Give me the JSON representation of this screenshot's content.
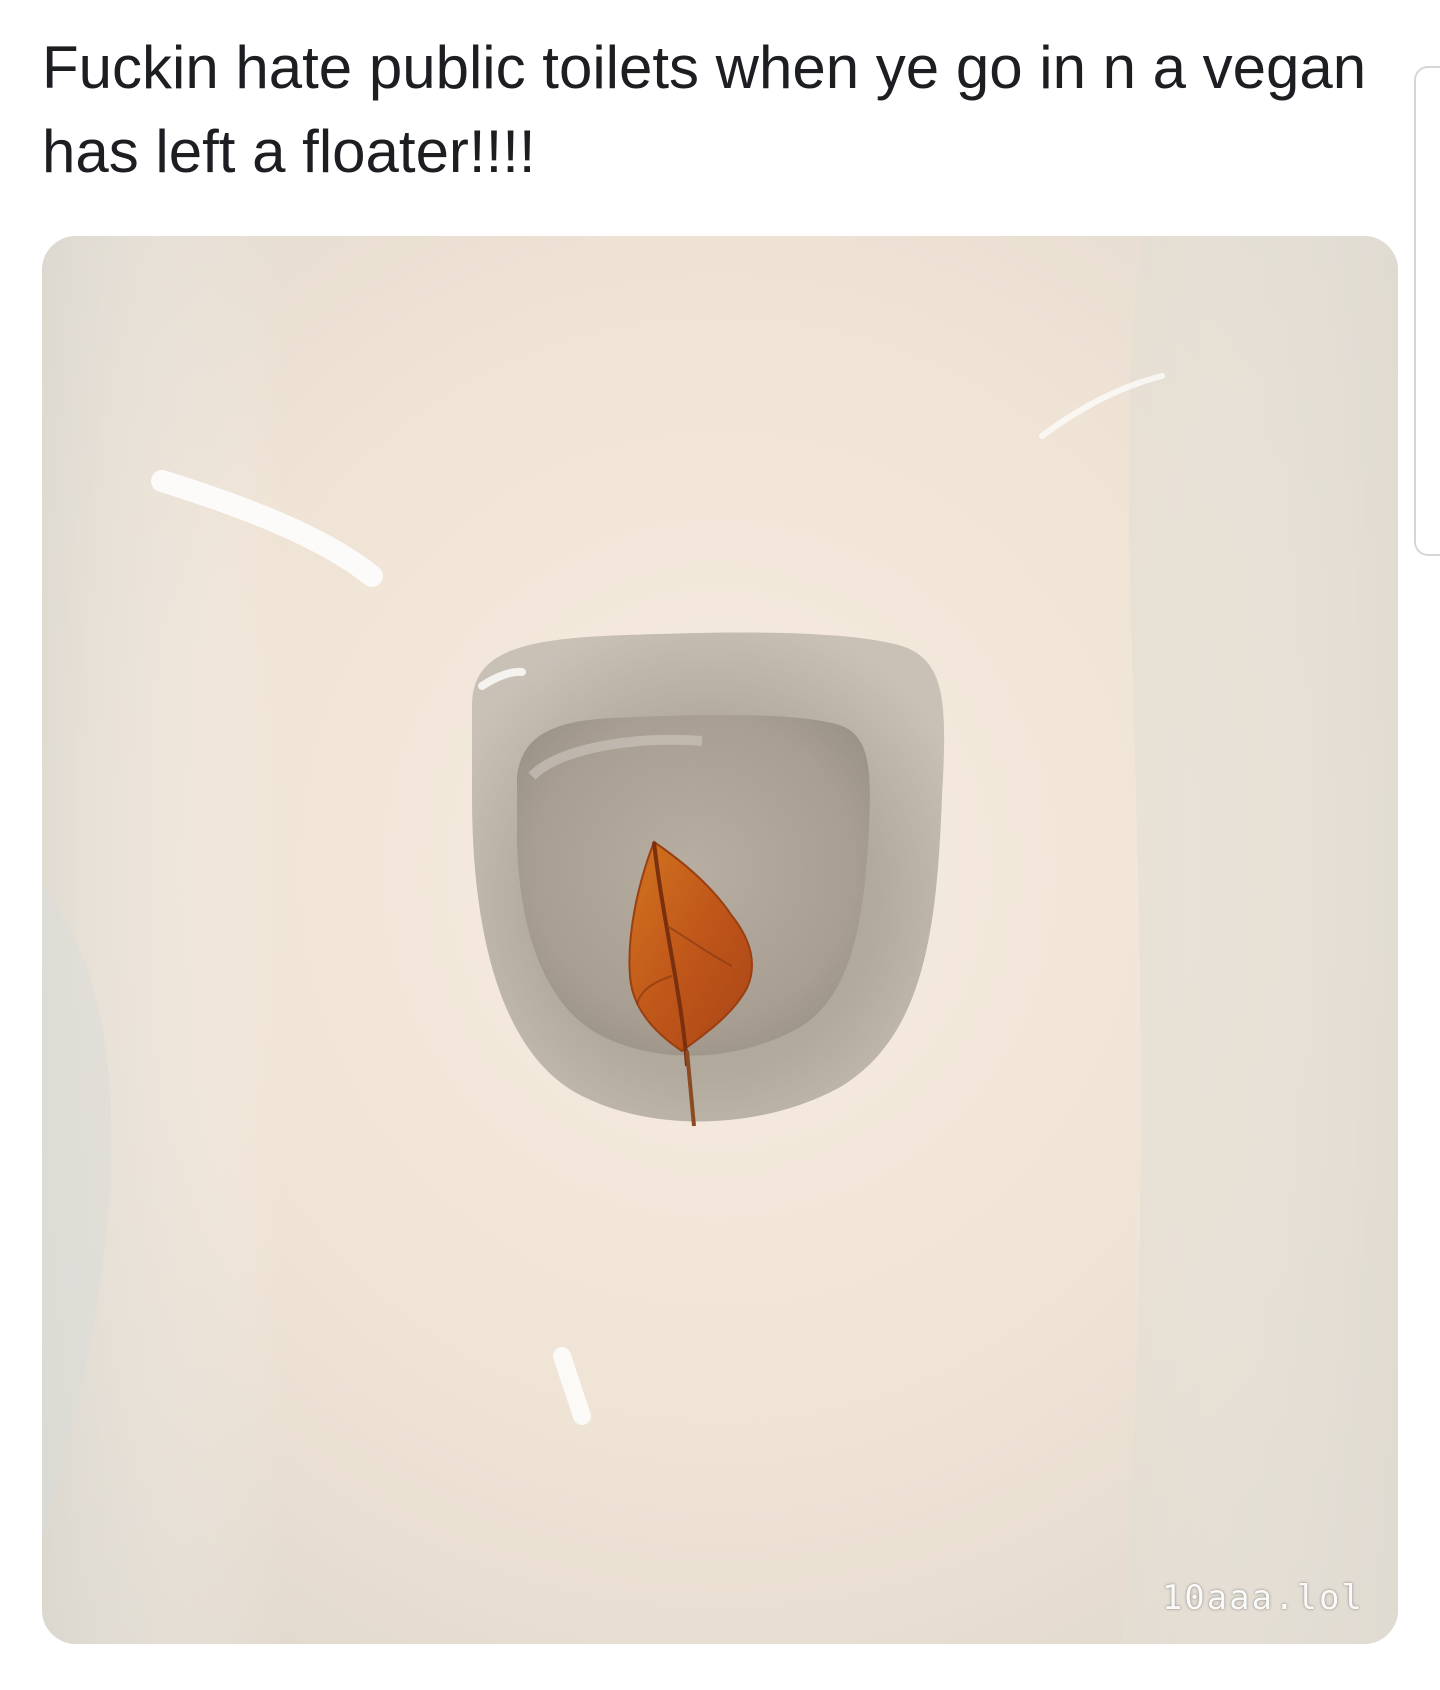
{
  "post": {
    "text": "Fuckin hate public toilets when ye go in n a vegan has left a floater!!!!"
  },
  "image": {
    "watermark": "10aaa.lol"
  },
  "colors": {
    "text": "#1c1e21",
    "porcelain": "#eee4d8",
    "bowl_water": "#b9b0a4",
    "leaf": "#c8641e"
  }
}
